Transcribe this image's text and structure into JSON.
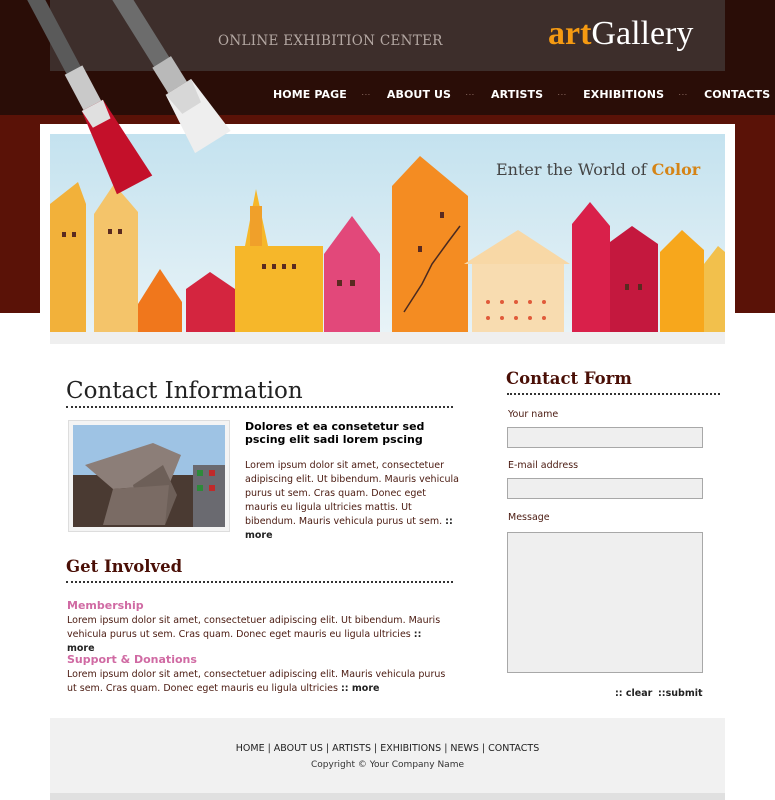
{
  "header": {
    "tagline": "ONLINE EXHIBITION CENTER",
    "logo_art": "art",
    "logo_gallery": "Gallery"
  },
  "nav": {
    "items": [
      {
        "label": "HOME PAGE"
      },
      {
        "label": "ABOUT US"
      },
      {
        "label": "ARTISTS"
      },
      {
        "label": "EXHIBITIONS"
      },
      {
        "label": "CONTACTS"
      }
    ]
  },
  "banner": {
    "slogan_prefix": "Enter the World of ",
    "slogan_word": "Color"
  },
  "contact_info": {
    "heading": "Contact Information",
    "teaser_title": "Dolores et ea consetetur sed pscing elit sadi lorem pscing",
    "teaser_body": "Lorem ipsum dolor sit amet, consectetuer adipiscing elit. Ut bibendum. Mauris vehicula purus ut sem. Cras quam. Donec eget mauris eu ligula ultricies mattis. Ut bibendum. Mauris vehicula purus ut sem.",
    "more": ":: more"
  },
  "get_involved": {
    "heading": "Get Involved",
    "membership_title": "Membership",
    "membership_body": "Lorem ipsum dolor sit amet, consectetuer adipiscing elit. Ut bibendum. Mauris vehicula purus ut sem. Cras quam. Donec eget mauris eu ligula ultricies",
    "membership_more": ":: more",
    "support_title": "Support & Donations",
    "support_body": "Lorem ipsum dolor sit amet, consectetuer adipiscing elit. Mauris vehicula purus ut sem. Cras quam. Donec eget mauris eu ligula ultricies",
    "support_more": ":: more"
  },
  "form": {
    "heading": "Contact Form",
    "name_label": "Your name",
    "name_value": "",
    "email_label": "E-mail address",
    "email_value": "",
    "message_label": "Message",
    "message_value": "",
    "clear_label": ":: clear",
    "submit_label": "::submit"
  },
  "footer": {
    "links": [
      "HOME",
      "ABOUT US",
      "ARTISTS",
      "EXHIBITIONS",
      "NEWS",
      "CONTACTS"
    ],
    "copyright": "Copyright © Your Company Name"
  },
  "colors": {
    "header_dark": "#2a0d07",
    "header_red": "#5a1207",
    "logo_accent": "#f59a12",
    "heading_brown": "#4a0f06",
    "pink_link": "#d06aa3"
  }
}
